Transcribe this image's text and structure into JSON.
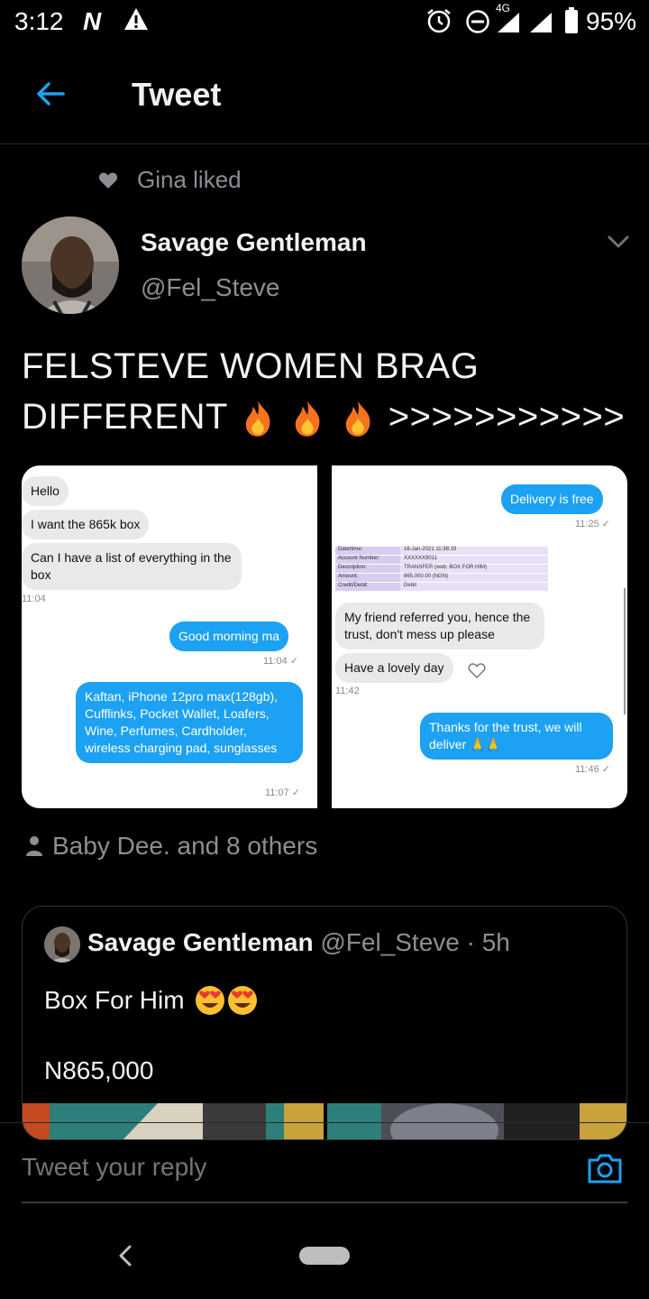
{
  "status_bar": {
    "time": "3:12",
    "carrier_icon": "N",
    "network": "4G",
    "battery": "95%"
  },
  "header": {
    "title": "Tweet",
    "back_icon": "arrow-left-icon"
  },
  "social_context": {
    "text": "Gina liked"
  },
  "author": {
    "name": "Savage Gentleman",
    "handle": "@Fel_Steve"
  },
  "tweet": {
    "text": "FELSTEVE WOMEN BRAG DIFFERENT",
    "suffix": ">>>>>>>>>>>",
    "emojis": [
      "fire",
      "fire",
      "fire"
    ]
  },
  "media": {
    "left": {
      "messages": [
        {
          "dir": "in",
          "text": "Hello"
        },
        {
          "dir": "in",
          "text": "I want the 865k box"
        },
        {
          "dir": "in",
          "text": "Can I have a list of everything in the box"
        },
        {
          "dir": "out",
          "text": "Good morning ma"
        },
        {
          "dir": "out",
          "text": "Kaftan, iPhone 12pro max(128gb), Cufflinks, Pocket Wallet, Loafers, Wine, Perfumes, Cardholder, wireless charging pad, sunglasses"
        }
      ],
      "times": [
        "11:04",
        "11:04 ✓",
        "11:07 ✓"
      ]
    },
    "right": {
      "messages": [
        {
          "dir": "out",
          "text": "Delivery is free"
        },
        {
          "dir": "in",
          "text": "My friend referred you, hence the trust, don't mess up please"
        },
        {
          "dir": "in",
          "text": "Have a lovely day"
        },
        {
          "dir": "out",
          "text": "Thanks for the trust, we will deliver 🙏🙏"
        }
      ],
      "times": [
        "11:25 ✓",
        "11:42",
        "11:46 ✓"
      ],
      "receipt": [
        {
          "k": "Date/time:",
          "v": "16-Jan-2021 11:38:19"
        },
        {
          "k": "Account Number:",
          "v": "XXXXXX9011"
        },
        {
          "k": "Description:",
          "v": "TRANSFER (web: BOX FOR HIM)"
        },
        {
          "k": "Amount:",
          "v": "865,000.00 (NGN)"
        },
        {
          "k": "Credit/Debit:",
          "v": "Debit"
        }
      ]
    }
  },
  "likers": {
    "text": "Baby Dee. and 8 others"
  },
  "quote": {
    "name": "Savage Gentleman",
    "handle": "@Fel_Steve",
    "separator": "·",
    "time": "5h",
    "text": "Box For Him",
    "emojis": [
      "heart-eyes",
      "heart-eyes"
    ],
    "price": "N865,000"
  },
  "reply": {
    "placeholder": "Tweet your reply"
  },
  "colors": {
    "accent": "#1da1f2",
    "background": "#000000",
    "muted": "#8b8f94"
  }
}
